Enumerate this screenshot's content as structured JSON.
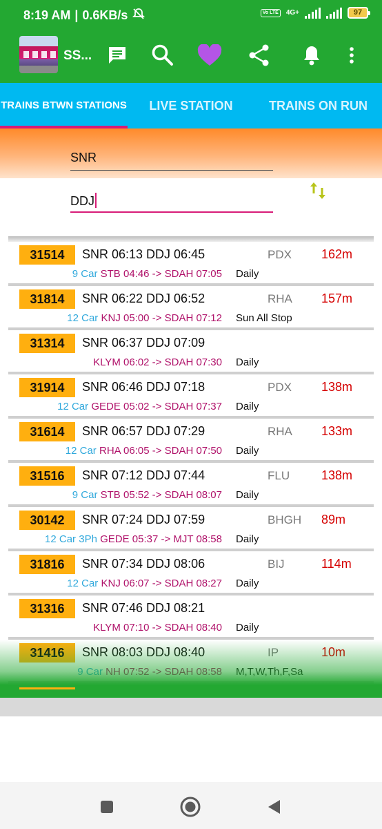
{
  "status_bar": {
    "time": "8:19 AM",
    "speed": "0.6KB/s",
    "network": "4G+",
    "volte": "Vo LTE",
    "battery": "97"
  },
  "app_bar": {
    "title": "SS...",
    "icons": [
      "chat-icon",
      "search-icon",
      "heart-icon",
      "share-icon",
      "bell-icon",
      "more-vert-icon"
    ],
    "accent": "#23a832"
  },
  "tabs": [
    {
      "label": "TRAINS BTWN STATIONS",
      "active": true
    },
    {
      "label": "LIVE STATION",
      "active": false
    },
    {
      "label": "TRAINS ON RUN",
      "active": false
    }
  ],
  "search": {
    "from": "SNR",
    "to": "DDJ"
  },
  "trains": [
    {
      "no": "31514",
      "timing": "SNR 06:13 DDJ 06:45",
      "mid": "PDX",
      "dist": "162m",
      "car": "9 Car",
      "route": "STB 04:46 -> SDAH 07:05",
      "days": "Daily"
    },
    {
      "no": "31814",
      "timing": "SNR 06:22 DDJ 06:52",
      "mid": "RHA",
      "dist": "157m",
      "car": "12 Car",
      "route": "KNJ 05:00 -> SDAH 07:12",
      "days": "Sun All Stop"
    },
    {
      "no": "31314",
      "timing": "SNR 06:37 DDJ 07:09",
      "mid": "",
      "dist": "",
      "car": "",
      "route": "KLYM 06:02 -> SDAH 07:30",
      "days": "Daily"
    },
    {
      "no": "31914",
      "timing": "SNR 06:46 DDJ 07:18",
      "mid": "PDX",
      "dist": "138m",
      "car": "12 Car",
      "route": "GEDE 05:02 -> SDAH 07:37",
      "days": "Daily"
    },
    {
      "no": "31614",
      "timing": "SNR 06:57 DDJ 07:29",
      "mid": "RHA",
      "dist": "133m",
      "car": "12 Car",
      "route": "RHA 06:05 -> SDAH 07:50",
      "days": "Daily"
    },
    {
      "no": "31516",
      "timing": "SNR 07:12 DDJ 07:44",
      "mid": "FLU",
      "dist": "138m",
      "car": "9 Car",
      "route": "STB 05:52 -> SDAH 08:07",
      "days": "Daily"
    },
    {
      "no": "30142",
      "timing": "SNR 07:24 DDJ 07:59",
      "mid": "BHGH",
      "dist": "89m",
      "car": "12 Car 3Ph",
      "route": "GEDE 05:37 -> MJT 08:58",
      "days": "Daily"
    },
    {
      "no": "31816",
      "timing": "SNR 07:34 DDJ 08:06",
      "mid": "BIJ",
      "dist": "114m",
      "car": "12 Car",
      "route": "KNJ 06:07 -> SDAH 08:27",
      "days": "Daily"
    },
    {
      "no": "31316",
      "timing": "SNR 07:46 DDJ 08:21",
      "mid": "",
      "dist": "",
      "car": "",
      "route": "KLYM 07:10 -> SDAH 08:40",
      "days": "Daily"
    },
    {
      "no": "31416",
      "timing": "SNR 08:03 DDJ 08:40",
      "mid": "IP",
      "dist": "10m",
      "car": "9 Car",
      "route": "NH 07:52 -> SDAH 08:58",
      "days": "M,T,W,Th,F,Sa"
    }
  ],
  "nav": [
    "recents-icon",
    "home-icon",
    "back-icon"
  ]
}
